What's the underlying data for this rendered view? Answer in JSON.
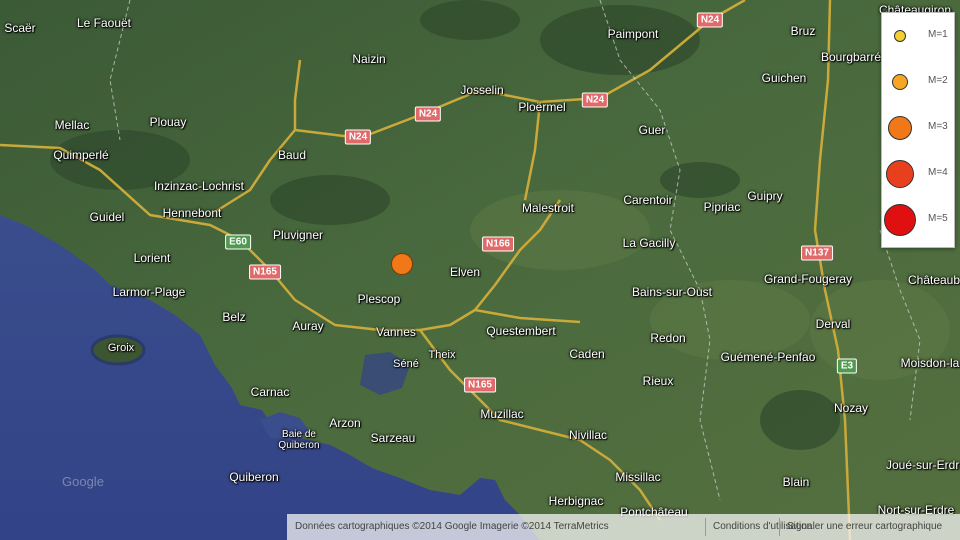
{
  "places": [
    {
      "name": "Scaër",
      "key": "scaer"
    },
    {
      "name": "Le Faouët",
      "key": "le-faouet"
    },
    {
      "name": "Naizin",
      "key": "naizin"
    },
    {
      "name": "Paimpont",
      "key": "paimpont"
    },
    {
      "name": "Bruz",
      "key": "bruz"
    },
    {
      "name": "Bourgbarré",
      "key": "bourgbarre"
    },
    {
      "name": "Châteaugiron",
      "key": "chateaugiron"
    },
    {
      "name": "Josselin",
      "key": "josselin"
    },
    {
      "name": "Ploërmel",
      "key": "ploermel"
    },
    {
      "name": "Guichen",
      "key": "guichen"
    },
    {
      "name": "Mellac",
      "key": "mellac"
    },
    {
      "name": "Plouay",
      "key": "plouay"
    },
    {
      "name": "Quimperlé",
      "key": "quimperle"
    },
    {
      "name": "Baud",
      "key": "baud"
    },
    {
      "name": "Guer",
      "key": "guer"
    },
    {
      "name": "Inzinzac-Lochrist",
      "key": "inzinzac-lochrist"
    },
    {
      "name": "Carentoir",
      "key": "carentoir"
    },
    {
      "name": "Guipry",
      "key": "guipry"
    },
    {
      "name": "Hennebont",
      "key": "hennebont"
    },
    {
      "name": "Guidel",
      "key": "guidel"
    },
    {
      "name": "Malestroit",
      "key": "malestroit"
    },
    {
      "name": "Pipriac",
      "key": "pipriac"
    },
    {
      "name": "Pluvigner",
      "key": "pluvigner"
    },
    {
      "name": "La Gacilly",
      "key": "la-gacilly"
    },
    {
      "name": "Lorient",
      "key": "lorient"
    },
    {
      "name": "Elven",
      "key": "elven"
    },
    {
      "name": "Grand-Fougeray",
      "key": "grand-fougeray"
    },
    {
      "name": "Châteaub",
      "key": "chateaubriant"
    },
    {
      "name": "Larmor-Plage",
      "key": "larmor-plage"
    },
    {
      "name": "Plescop",
      "key": "plescop"
    },
    {
      "name": "Bains-sur-Oust",
      "key": "bains-sur-oust"
    },
    {
      "name": "Belz",
      "key": "belz"
    },
    {
      "name": "Auray",
      "key": "auray"
    },
    {
      "name": "Vannes",
      "key": "vannes"
    },
    {
      "name": "Questembert",
      "key": "questembert"
    },
    {
      "name": "Derval",
      "key": "derval"
    },
    {
      "name": "Redon",
      "key": "redon"
    },
    {
      "name": "Groix",
      "key": "groix"
    },
    {
      "name": "Séné",
      "key": "sene"
    },
    {
      "name": "Theix",
      "key": "theix"
    },
    {
      "name": "Caden",
      "key": "caden"
    },
    {
      "name": "Guémené-Penfao",
      "key": "guemene-penfao"
    },
    {
      "name": "Moisdon-la",
      "key": "moisdon"
    },
    {
      "name": "Carnac",
      "key": "carnac"
    },
    {
      "name": "Rieux",
      "key": "rieux"
    },
    {
      "name": "Baie de Quiberon",
      "key": "baie-de-quiberon"
    },
    {
      "name": "Arzon",
      "key": "arzon"
    },
    {
      "name": "Muzillac",
      "key": "muzillac"
    },
    {
      "name": "Nozay",
      "key": "nozay"
    },
    {
      "name": "Sarzeau",
      "key": "sarzeau"
    },
    {
      "name": "Nivillac",
      "key": "nivillac"
    },
    {
      "name": "Quiberon",
      "key": "quiberon"
    },
    {
      "name": "Missillac",
      "key": "missillac"
    },
    {
      "name": "Joué-sur-Erdre",
      "key": "joue-sur-erdre"
    },
    {
      "name": "Blain",
      "key": "blain"
    },
    {
      "name": "Herbignac",
      "key": "herbignac"
    },
    {
      "name": "Pontchâteau",
      "key": "pontchateau"
    },
    {
      "name": "Nort-sur-Erdre",
      "key": "nort-sur-erdre"
    }
  ],
  "road_shields": [
    {
      "label": "N24",
      "kind": "n"
    },
    {
      "label": "N24",
      "kind": "n"
    },
    {
      "label": "N24",
      "kind": "n"
    },
    {
      "label": "N24",
      "kind": "n"
    },
    {
      "label": "N166",
      "kind": "n"
    },
    {
      "label": "N137",
      "kind": "n"
    },
    {
      "label": "N165",
      "kind": "n"
    },
    {
      "label": "N165",
      "kind": "n"
    },
    {
      "label": "E60",
      "kind": "e"
    },
    {
      "label": "E3",
      "kind": "e"
    }
  ],
  "earthquake_marker": {
    "magnitude": 2,
    "color": "#f07818"
  },
  "legend": {
    "items": [
      {
        "label": "M=1",
        "magnitude": 1,
        "color": "#f2d030"
      },
      {
        "label": "M=2",
        "magnitude": 2,
        "color": "#f5a623"
      },
      {
        "label": "M=3",
        "magnitude": 3,
        "color": "#f07818"
      },
      {
        "label": "M=4",
        "magnitude": 4,
        "color": "#e8401c"
      },
      {
        "label": "M=5",
        "magnitude": 5,
        "color": "#e01010"
      }
    ]
  },
  "attribution": {
    "data": "Données cartographiques ©2014 Google Imagerie ©2014 TerraMetrics",
    "terms": "Conditions d'utilisation",
    "report": "Signaler une erreur cartographique"
  },
  "watermark": "Google"
}
